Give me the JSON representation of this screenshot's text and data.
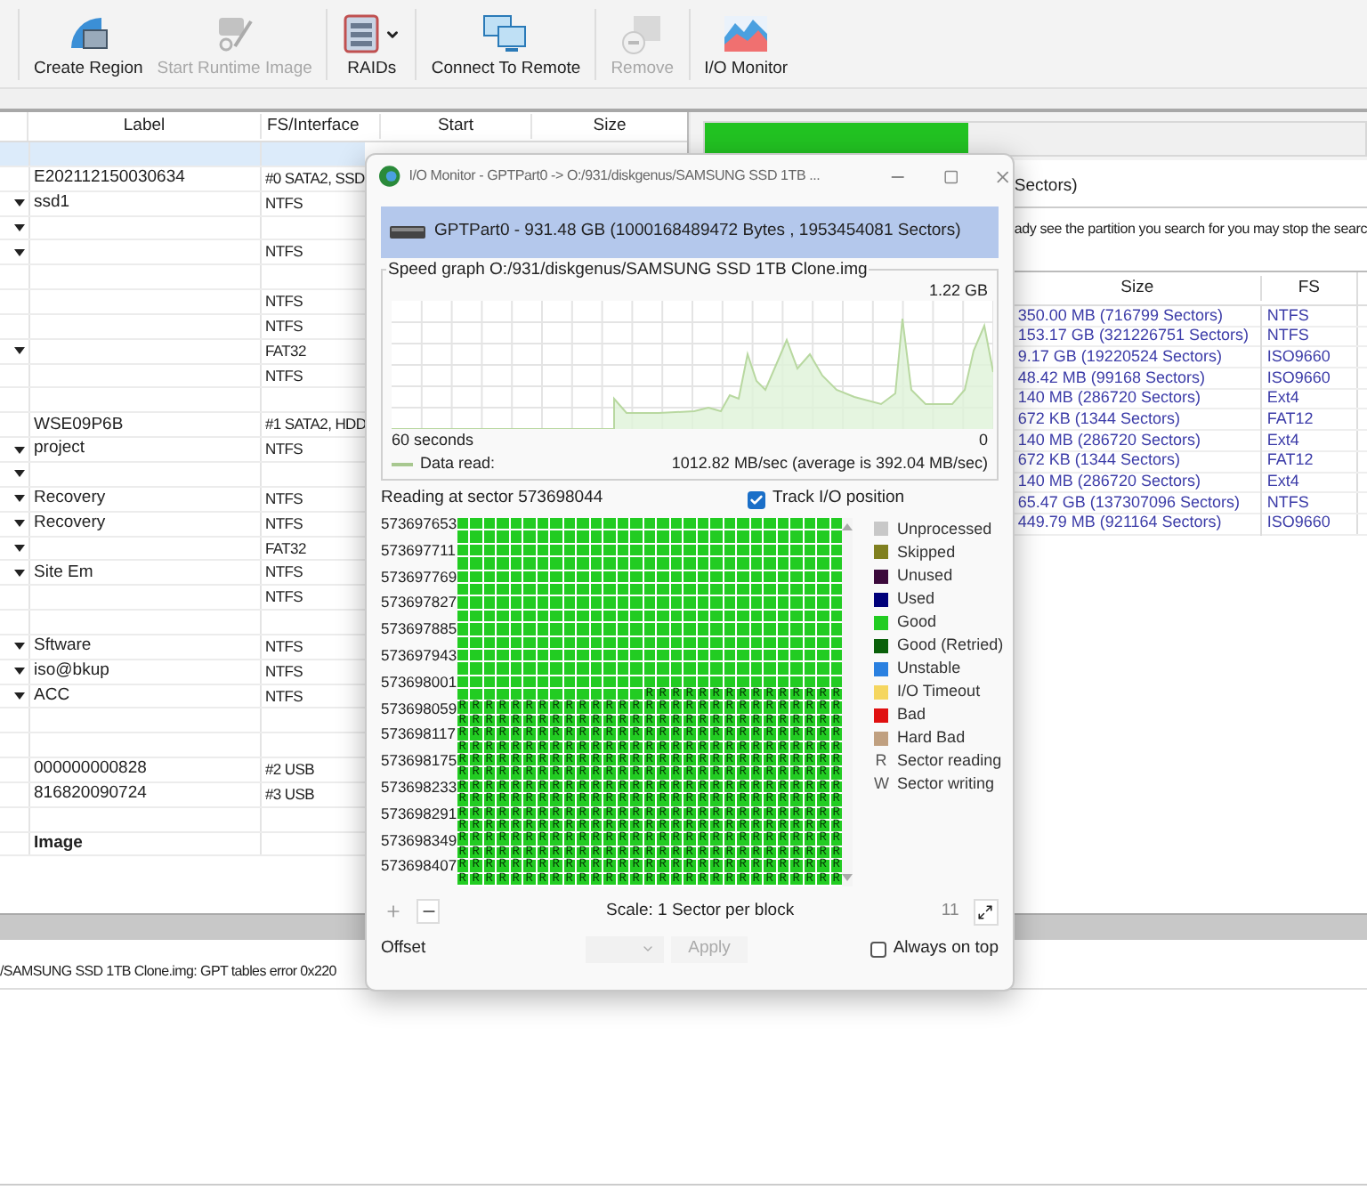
{
  "toolbar": {
    "items": [
      {
        "label": "Create Region",
        "kind": "region",
        "disabled": false,
        "dropdown": false
      },
      {
        "label": "Start Runtime Image",
        "kind": "runtime",
        "disabled": true,
        "dropdown": false
      },
      {
        "label": "RAIDs",
        "kind": "raid",
        "disabled": false,
        "dropdown": true
      },
      {
        "label": "Connect To Remote",
        "kind": "remote",
        "disabled": false,
        "dropdown": false
      },
      {
        "label": "Remove",
        "kind": "remove",
        "disabled": true,
        "dropdown": false
      },
      {
        "label": "I/O Monitor",
        "kind": "monitor",
        "disabled": false,
        "dropdown": false
      }
    ]
  },
  "left_table": {
    "columns": [
      "Label",
      "FS/Interface",
      "Start",
      "Size"
    ],
    "rows": [
      {
        "menu": false,
        "selected": true
      },
      {
        "menu": false,
        "selected": false,
        "bold": false,
        "label": "E202112150030634",
        "fs": "#0 SATA2, SSD"
      },
      {
        "menu": true,
        "selected": false,
        "bold": false,
        "label": "ssd1",
        "fs": "NTFS"
      },
      {
        "menu": true,
        "selected": false
      },
      {
        "menu": true,
        "selected": false,
        "fs": "NTFS"
      },
      {
        "menu": false,
        "selected": false
      },
      {
        "menu": false,
        "selected": false,
        "fs": "NTFS"
      },
      {
        "menu": false,
        "selected": false,
        "fs": "NTFS"
      },
      {
        "menu": true,
        "selected": false,
        "fs": "FAT32"
      },
      {
        "menu": false,
        "selected": false,
        "fs": "NTFS"
      },
      {
        "menu": false,
        "selected": false
      },
      {
        "menu": false,
        "selected": false,
        "bold": false,
        "label": "WSE09P6B",
        "fs": "#1 SATA2, HDD"
      },
      {
        "menu": true,
        "selected": false,
        "bold": false,
        "label": "project",
        "fs": "NTFS"
      },
      {
        "menu": true,
        "selected": false
      },
      {
        "menu": true,
        "selected": false,
        "bold": false,
        "label": "Recovery",
        "fs": "NTFS"
      },
      {
        "menu": true,
        "selected": false,
        "bold": false,
        "label": "Recovery",
        "fs": "NTFS"
      },
      {
        "menu": true,
        "selected": false,
        "fs": "FAT32"
      },
      {
        "menu": true,
        "selected": false,
        "bold": false,
        "label": "Site Em",
        "fs": "NTFS"
      },
      {
        "menu": false,
        "selected": false,
        "fs": "NTFS"
      },
      {
        "menu": false,
        "selected": false
      },
      {
        "menu": true,
        "selected": false,
        "bold": false,
        "label": "Sftware",
        "fs": "NTFS"
      },
      {
        "menu": true,
        "selected": false,
        "bold": false,
        "label": "iso@bkup",
        "fs": "NTFS"
      },
      {
        "menu": true,
        "selected": false,
        "bold": false,
        "label": "ACC",
        "fs": "NTFS"
      },
      {
        "menu": false,
        "selected": false
      },
      {
        "menu": false,
        "selected": false
      },
      {
        "menu": false,
        "selected": false,
        "bold": false,
        "label": "000000000828",
        "fs": "#2 USB"
      },
      {
        "menu": false,
        "selected": false,
        "bold": false,
        "label": "816820090724",
        "fs": "#3 USB"
      },
      {
        "menu": false,
        "selected": false
      },
      {
        "menu": false,
        "selected": false,
        "bold": true,
        "label": "Image"
      }
    ]
  },
  "right_panel": {
    "progress": {
      "level": 0.4
    },
    "lines": [
      "Sectors)",
      "ady see the partition you search for you may stop the searc"
    ],
    "table": {
      "columns": [
        "Size",
        "FS"
      ],
      "rows": [
        {
          "size": "350.00 MB (716799 Sectors)",
          "fs": "NTFS"
        },
        {
          "size": "153.17 GB (321226751 Sectors)",
          "fs": "NTFS"
        },
        {
          "size": "9.17 GB (19220524 Sectors)",
          "fs": "ISO9660"
        },
        {
          "size": "48.42 MB (99168 Sectors)",
          "fs": "ISO9660"
        },
        {
          "size": "140 MB (286720 Sectors)",
          "fs": "Ext4"
        },
        {
          "size": "672 KB (1344 Sectors)",
          "fs": "FAT12"
        },
        {
          "size": "140 MB (286720 Sectors)",
          "fs": "Ext4"
        },
        {
          "size": "672 KB (1344 Sectors)",
          "fs": "FAT12"
        },
        {
          "size": "140 MB (286720 Sectors)",
          "fs": "Ext4"
        },
        {
          "size": "65.47 GB (137307096 Sectors)",
          "fs": "NTFS"
        },
        {
          "size": "449.79 MB (921164 Sectors)",
          "fs": "ISO9660"
        }
      ]
    }
  },
  "log": {
    "lines": [
      "/SAMSUNG SSD 1TB Clone.img: GPT tables error 0x220"
    ]
  },
  "dialog": {
    "title": "I/O Monitor - GPTPart0 -> O:/931/diskgenus/SAMSUNG SSD 1TB ...",
    "disk": "GPTPart0 - 931.48 GB (1000168489472 Bytes , 1953454081 Sectors)",
    "speed_graph": {
      "title": "Speed graph O:/931/diskgenus/SAMSUNG SSD 1TB Clone.img",
      "max_label": "1.22 GB",
      "time_label": "60 seconds",
      "min_label": "0",
      "legend": "Data read:",
      "rate": "1012.82 MB/sec (average is 392.04 MB/sec)"
    },
    "reading": "Reading at sector 573698044",
    "track_io": {
      "label": "Track I/O position",
      "checked": true
    },
    "sector_map": {
      "addresses": [
        "573697653",
        "573697711",
        "573697769",
        "573697827",
        "573697885",
        "573697943",
        "573698001",
        "573698059",
        "573698117",
        "573698175",
        "573698233",
        "573698291",
        "573698349",
        "573698407"
      ],
      "mark_rows": [
        "              RRRRRRRRRRRRRRR",
        "RRRRRRRRRRRRRRRRRRRRRRRRRRRRR",
        "RRRRRRRRRRRRRRRRRRRRRRRRRRRRR",
        "RRRRRRRRRRRRRRRRRRRRRRRRRRRRR",
        "RRRRRRRRRRRRRRRRRRRRRRRRRRRRR",
        "RRRRRRRRRRRRRRRRRRRRRRRRRRRRR",
        "RRRRRRRRRRRRRRRRRRRRRRRRRRRRR",
        "RRRRRRRRRRRRRRRRRRRRRRRRRRRRR",
        "RRRRRRRRRRRRRRRRRRRRRRRRRRRRR",
        "RRRRRRRRRRRRRRRRRRRRRRRRRRRRR",
        "RRRRRRRRRRRRRRRRRRRRRRRRRRRRR",
        "RRRRRRRRRRRRRRRRRRRRRRRRRRRRR",
        "RRRRRRRRRRRRRRRRRRRRRRRRRRRRR",
        "RRRRRRRRRRRRRRRRRRRRRRRRRRRRR",
        "RRRRRRRRRRRRRRRRRRRRRRRRRRRRR"
      ]
    },
    "legend": [
      {
        "kind": "swatch",
        "label": "Unprocessed",
        "color": "#c8c8c8"
      },
      {
        "kind": "swatch",
        "label": "Skipped",
        "color": "#808020"
      },
      {
        "kind": "swatch",
        "label": "Unused",
        "color": "#3c0a3c"
      },
      {
        "kind": "swatch",
        "label": "Used",
        "color": "#00007a"
      },
      {
        "kind": "swatch",
        "label": "Good",
        "color": "#22cc22"
      },
      {
        "kind": "swatch",
        "label": "Good (Retried)",
        "color": "#0a600a"
      },
      {
        "kind": "swatch",
        "label": "Unstable",
        "color": "#2a80e0"
      },
      {
        "kind": "swatch",
        "label": "I/O Timeout",
        "color": "#f5d660"
      },
      {
        "kind": "swatch",
        "label": "Bad",
        "color": "#e01010"
      },
      {
        "kind": "swatch",
        "label": "Hard Bad",
        "color": "#c0a080"
      },
      {
        "kind": "letter",
        "symbol": "R",
        "label": "Sector reading"
      },
      {
        "kind": "letter",
        "symbol": "W",
        "label": "Sector writing"
      }
    ],
    "scale": "Scale: 1 Sector per block",
    "zoom": "11",
    "offset_label": "Offset",
    "apply": {
      "label": "Apply",
      "disabled": true
    },
    "always_on_top": {
      "label": "Always on top",
      "checked": false
    }
  }
}
